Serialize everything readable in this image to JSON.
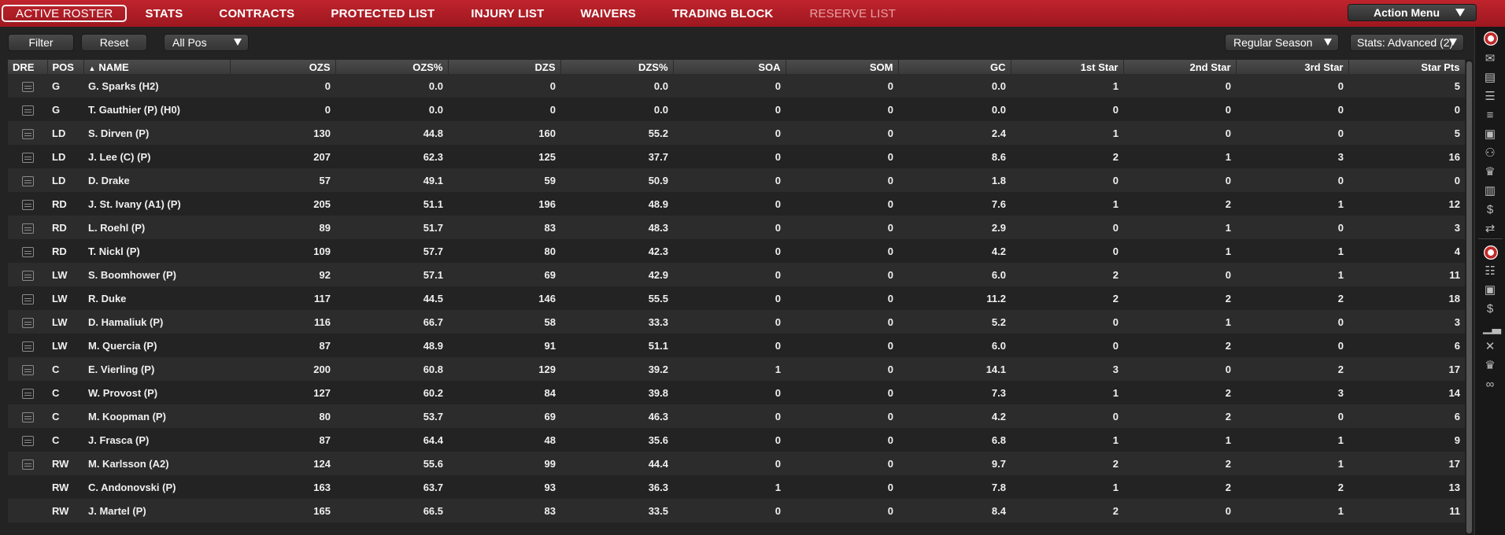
{
  "nav": {
    "tabs": [
      "ACTIVE ROSTER",
      "STATS",
      "CONTRACTS",
      "PROTECTED LIST",
      "INJURY LIST",
      "WAIVERS",
      "TRADING BLOCK",
      "RESERVE LIST"
    ],
    "active_index": 0,
    "disabled_index": 7,
    "action_menu": "Action Menu"
  },
  "toolbar": {
    "filter": "Filter",
    "reset": "Reset",
    "position_filter": "All Pos",
    "season": "Regular Season",
    "stats_view": "Stats: Advanced (2)"
  },
  "table": {
    "columns": [
      "DRE",
      "POS",
      "NAME",
      "OZS",
      "OZS%",
      "DZS",
      "DZS%",
      "SOA",
      "SOM",
      "GC",
      "1st Star",
      "2nd Star",
      "3rd Star",
      "Star Pts"
    ],
    "sorted_column": "NAME",
    "rows": [
      {
        "dre": true,
        "pos": "G",
        "name": "G. Sparks (H2)",
        "ozs": "0",
        "ozsp": "0.0",
        "dzs": "0",
        "dzsp": "0.0",
        "soa": "0",
        "som": "0",
        "gc": "0.0",
        "s1": "1",
        "s2": "0",
        "s3": "0",
        "pts": "5"
      },
      {
        "dre": true,
        "pos": "G",
        "name": "T. Gauthier (P) (H0)",
        "ozs": "0",
        "ozsp": "0.0",
        "dzs": "0",
        "dzsp": "0.0",
        "soa": "0",
        "som": "0",
        "gc": "0.0",
        "s1": "0",
        "s2": "0",
        "s3": "0",
        "pts": "0"
      },
      {
        "dre": true,
        "pos": "LD",
        "name": "S. Dirven (P)",
        "ozs": "130",
        "ozsp": "44.8",
        "dzs": "160",
        "dzsp": "55.2",
        "soa": "0",
        "som": "0",
        "gc": "2.4",
        "s1": "1",
        "s2": "0",
        "s3": "0",
        "pts": "5"
      },
      {
        "dre": true,
        "pos": "LD",
        "name": "J. Lee (C) (P)",
        "ozs": "207",
        "ozsp": "62.3",
        "dzs": "125",
        "dzsp": "37.7",
        "soa": "0",
        "som": "0",
        "gc": "8.6",
        "s1": "2",
        "s2": "1",
        "s3": "3",
        "pts": "16"
      },
      {
        "dre": true,
        "pos": "LD",
        "name": "D. Drake",
        "ozs": "57",
        "ozsp": "49.1",
        "dzs": "59",
        "dzsp": "50.9",
        "soa": "0",
        "som": "0",
        "gc": "1.8",
        "s1": "0",
        "s2": "0",
        "s3": "0",
        "pts": "0"
      },
      {
        "dre": true,
        "pos": "RD",
        "name": "J. St. Ivany (A1) (P)",
        "ozs": "205",
        "ozsp": "51.1",
        "dzs": "196",
        "dzsp": "48.9",
        "soa": "0",
        "som": "0",
        "gc": "7.6",
        "s1": "1",
        "s2": "2",
        "s3": "1",
        "pts": "12"
      },
      {
        "dre": true,
        "pos": "RD",
        "name": "L. Roehl (P)",
        "ozs": "89",
        "ozsp": "51.7",
        "dzs": "83",
        "dzsp": "48.3",
        "soa": "0",
        "som": "0",
        "gc": "2.9",
        "s1": "0",
        "s2": "1",
        "s3": "0",
        "pts": "3"
      },
      {
        "dre": true,
        "pos": "RD",
        "name": "T. Nickl (P)",
        "ozs": "109",
        "ozsp": "57.7",
        "dzs": "80",
        "dzsp": "42.3",
        "soa": "0",
        "som": "0",
        "gc": "4.2",
        "s1": "0",
        "s2": "1",
        "s3": "1",
        "pts": "4"
      },
      {
        "dre": true,
        "pos": "LW",
        "name": "S. Boomhower (P)",
        "ozs": "92",
        "ozsp": "57.1",
        "dzs": "69",
        "dzsp": "42.9",
        "soa": "0",
        "som": "0",
        "gc": "6.0",
        "s1": "2",
        "s2": "0",
        "s3": "1",
        "pts": "11"
      },
      {
        "dre": true,
        "pos": "LW",
        "name": "R. Duke",
        "ozs": "117",
        "ozsp": "44.5",
        "dzs": "146",
        "dzsp": "55.5",
        "soa": "0",
        "som": "0",
        "gc": "11.2",
        "s1": "2",
        "s2": "2",
        "s3": "2",
        "pts": "18"
      },
      {
        "dre": true,
        "pos": "LW",
        "name": "D. Hamaliuk (P)",
        "ozs": "116",
        "ozsp": "66.7",
        "dzs": "58",
        "dzsp": "33.3",
        "soa": "0",
        "som": "0",
        "gc": "5.2",
        "s1": "0",
        "s2": "1",
        "s3": "0",
        "pts": "3"
      },
      {
        "dre": true,
        "pos": "LW",
        "name": "M. Quercia (P)",
        "ozs": "87",
        "ozsp": "48.9",
        "dzs": "91",
        "dzsp": "51.1",
        "soa": "0",
        "som": "0",
        "gc": "6.0",
        "s1": "0",
        "s2": "2",
        "s3": "0",
        "pts": "6"
      },
      {
        "dre": true,
        "pos": "C",
        "name": "E. Vierling (P)",
        "ozs": "200",
        "ozsp": "60.8",
        "dzs": "129",
        "dzsp": "39.2",
        "soa": "1",
        "som": "0",
        "gc": "14.1",
        "s1": "3",
        "s2": "0",
        "s3": "2",
        "pts": "17"
      },
      {
        "dre": true,
        "pos": "C",
        "name": "W. Provost (P)",
        "ozs": "127",
        "ozsp": "60.2",
        "dzs": "84",
        "dzsp": "39.8",
        "soa": "0",
        "som": "0",
        "gc": "7.3",
        "s1": "1",
        "s2": "2",
        "s3": "3",
        "pts": "14"
      },
      {
        "dre": true,
        "pos": "C",
        "name": "M. Koopman (P)",
        "ozs": "80",
        "ozsp": "53.7",
        "dzs": "69",
        "dzsp": "46.3",
        "soa": "0",
        "som": "0",
        "gc": "4.2",
        "s1": "0",
        "s2": "2",
        "s3": "0",
        "pts": "6"
      },
      {
        "dre": true,
        "pos": "C",
        "name": "J. Frasca (P)",
        "ozs": "87",
        "ozsp": "64.4",
        "dzs": "48",
        "dzsp": "35.6",
        "soa": "0",
        "som": "0",
        "gc": "6.8",
        "s1": "1",
        "s2": "1",
        "s3": "1",
        "pts": "9"
      },
      {
        "dre": true,
        "pos": "RW",
        "name": "M. Karlsson (A2)",
        "ozs": "124",
        "ozsp": "55.6",
        "dzs": "99",
        "dzsp": "44.4",
        "soa": "0",
        "som": "0",
        "gc": "9.7",
        "s1": "2",
        "s2": "2",
        "s3": "1",
        "pts": "17"
      },
      {
        "dre": false,
        "pos": "RW",
        "name": "C. Andonovski (P)",
        "ozs": "163",
        "ozsp": "63.7",
        "dzs": "93",
        "dzsp": "36.3",
        "soa": "1",
        "som": "0",
        "gc": "7.8",
        "s1": "1",
        "s2": "2",
        "s3": "2",
        "pts": "13"
      },
      {
        "dre": false,
        "pos": "RW",
        "name": "J. Martel (P)",
        "ozs": "165",
        "ozsp": "66.5",
        "dzs": "83",
        "dzsp": "33.5",
        "soa": "0",
        "som": "0",
        "gc": "8.4",
        "s1": "2",
        "s2": "0",
        "s3": "1",
        "pts": "11"
      }
    ]
  },
  "rail": {
    "icons": [
      "team-logo-icon",
      "mail-icon",
      "inbox-icon",
      "lines-icon",
      "list-icon",
      "game-icon",
      "people-icon",
      "trophy-icon",
      "clipboard-icon",
      "finance-icon",
      "transfer-icon",
      "league-logo-icon",
      "league-list-icon",
      "league-game-icon",
      "dollar-icon",
      "bar-chart-icon",
      "sticks-icon",
      "league-trophy-icon",
      "binoculars-icon"
    ]
  }
}
